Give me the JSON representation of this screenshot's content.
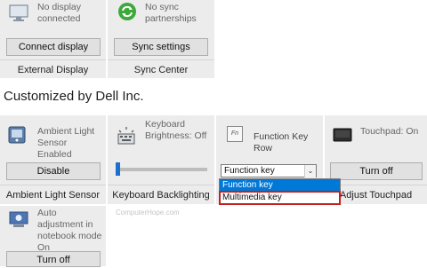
{
  "top_tiles": [
    {
      "status": "No display connected",
      "button": "Connect display",
      "caption": "External Display"
    },
    {
      "status": "No sync partnerships",
      "button": "Sync settings",
      "caption": "Sync Center"
    }
  ],
  "section_title": "Customized by Dell Inc.",
  "tiles": {
    "ambient": {
      "status": "Ambient Light Sensor Enabled",
      "button": "Disable",
      "caption": "Ambient Light Sensor"
    },
    "keyboard": {
      "status": "Keyboard Brightness: Off",
      "caption": "Keyboard Backlighting",
      "slider_level": 0
    },
    "fnrow": {
      "title": "Function Key Row",
      "icon_text": "Fn",
      "selected": "Function key",
      "options": [
        "Function key",
        "Multimedia key"
      ]
    },
    "touchpad": {
      "status": "Touchpad: On",
      "button": "Turn off",
      "caption": "Adjust Touchpad"
    },
    "notebook": {
      "status": "Auto adjustment in notebook mode On",
      "button": "Turn off"
    }
  },
  "dropdown_arrow": "⌄",
  "watermark": "ComputerHope.com",
  "colors": {
    "tile_bg": "#ececec",
    "selection": "#0078d7",
    "highlight_border": "#c0211d"
  }
}
